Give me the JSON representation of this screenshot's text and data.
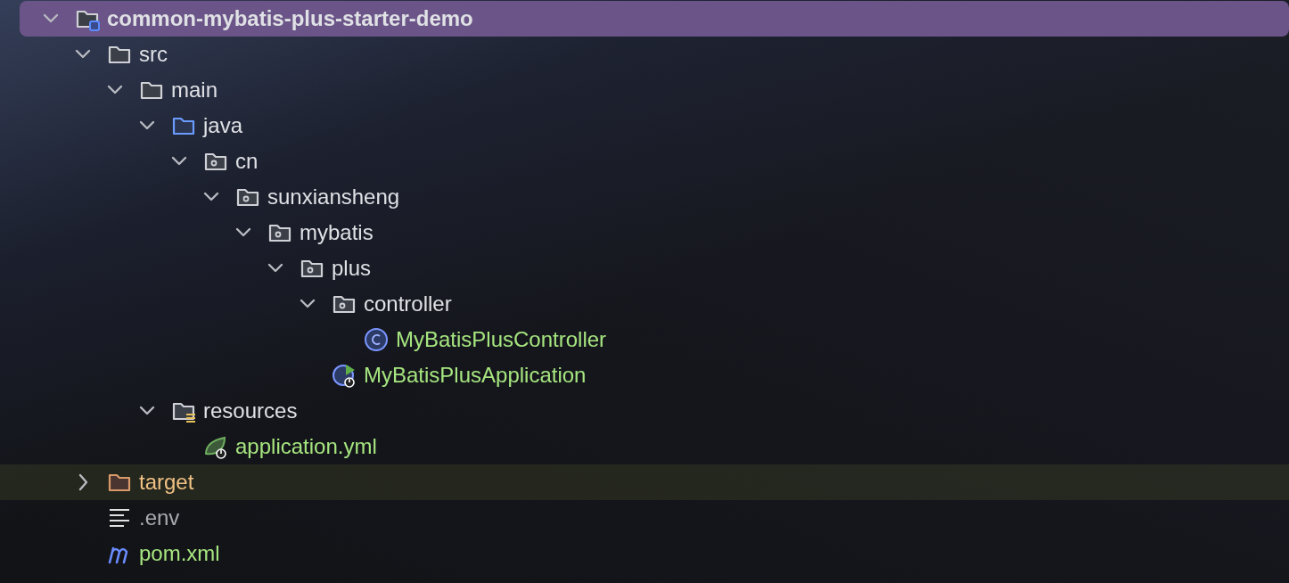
{
  "tree": [
    {
      "name": "common-mybatis-plus-starter-demo",
      "kind": "module",
      "expanded": true,
      "selected": true,
      "hovered": false,
      "children": [
        {
          "name": "src",
          "kind": "folder",
          "expanded": true,
          "selected": false,
          "hovered": false,
          "children": [
            {
              "name": "main",
              "kind": "folder",
              "expanded": true,
              "selected": false,
              "hovered": false,
              "children": [
                {
                  "name": "java",
                  "kind": "source-folder",
                  "expanded": true,
                  "selected": false,
                  "hovered": false,
                  "children": [
                    {
                      "name": "cn",
                      "kind": "package",
                      "expanded": true,
                      "selected": false,
                      "hovered": false,
                      "children": [
                        {
                          "name": "sunxiansheng",
                          "kind": "package",
                          "expanded": true,
                          "selected": false,
                          "hovered": false,
                          "children": [
                            {
                              "name": "mybatis",
                              "kind": "package",
                              "expanded": true,
                              "selected": false,
                              "hovered": false,
                              "children": [
                                {
                                  "name": "plus",
                                  "kind": "package",
                                  "expanded": true,
                                  "selected": false,
                                  "hovered": false,
                                  "children": [
                                    {
                                      "name": "controller",
                                      "kind": "package",
                                      "expanded": true,
                                      "selected": false,
                                      "hovered": false,
                                      "children": [
                                        {
                                          "name": "MyBatisPlusController",
                                          "kind": "class",
                                          "color": "#a6e57f",
                                          "selected": false,
                                          "hovered": false
                                        }
                                      ]
                                    },
                                    {
                                      "name": "MyBatisPlusApplication",
                                      "kind": "app-class",
                                      "color": "#a6e57f",
                                      "selected": false,
                                      "hovered": false
                                    }
                                  ]
                                }
                              ]
                            }
                          ]
                        }
                      ]
                    }
                  ]
                },
                {
                  "name": "resources",
                  "kind": "resource-folder",
                  "expanded": true,
                  "selected": false,
                  "hovered": false,
                  "children": [
                    {
                      "name": "application.yml",
                      "kind": "spring-config",
                      "color": "#a6e57f",
                      "selected": false,
                      "hovered": false
                    }
                  ]
                }
              ]
            }
          ]
        },
        {
          "name": "target",
          "kind": "excluded-folder",
          "color": "#f0c184",
          "expanded": false,
          "selected": false,
          "hovered": true
        },
        {
          "name": ".env",
          "kind": "text-file",
          "color": "#a9abb0",
          "selected": false,
          "hovered": false
        },
        {
          "name": "pom.xml",
          "kind": "maven",
          "color": "#a6e57f",
          "selected": false,
          "hovered": false
        }
      ]
    }
  ]
}
